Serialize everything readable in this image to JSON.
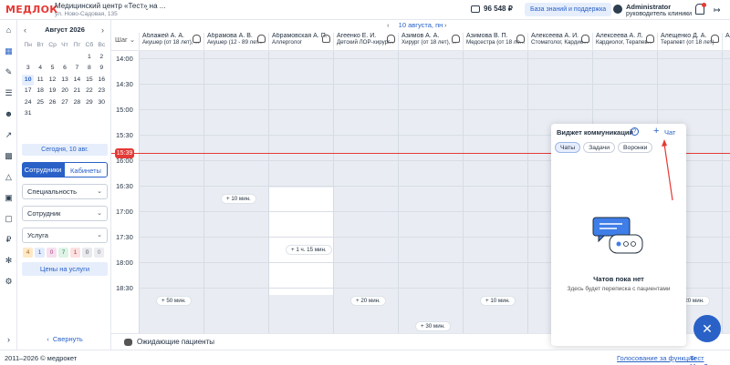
{
  "header": {
    "logo": "МЕДЛОК",
    "clinic_name": "Медицинский центр «Тест» на ...",
    "clinic_address": "ул. Ново-Садовая, 135",
    "balance": "96 548 ₽",
    "knowledge_base": "База знаний и поддержка",
    "user_name": "Administrator",
    "user_role": "руководитель клиники"
  },
  "calendar": {
    "month": "Август 2026",
    "weekdays": [
      "Пн",
      "Вт",
      "Ср",
      "Чт",
      "Пт",
      "Сб",
      "Вс"
    ],
    "weeks": [
      [
        "",
        "",
        "",
        "",
        "",
        "1",
        "2"
      ],
      [
        "3",
        "4",
        "5",
        "6",
        "7",
        "8",
        "9"
      ],
      [
        "10",
        "11",
        "12",
        "13",
        "14",
        "15",
        "16"
      ],
      [
        "17",
        "18",
        "19",
        "20",
        "21",
        "22",
        "23"
      ],
      [
        "24",
        "25",
        "26",
        "27",
        "28",
        "29",
        "30"
      ],
      [
        "31",
        "",
        "",
        "",
        "",
        "",
        ""
      ]
    ],
    "selected_day": "10",
    "today_button": "Сегодня, 10 авг."
  },
  "filters": {
    "tab_staff": "Сотрудники",
    "tab_rooms": "Кабинеты",
    "specialty": "Специальность",
    "employee": "Сотрудник",
    "service": "Услуга",
    "badges": [
      {
        "value": "4",
        "bg": "#fde9c8",
        "fg": "#a8641a"
      },
      {
        "value": "1",
        "bg": "#e3ecfb",
        "fg": "#2961c7"
      },
      {
        "value": "0",
        "bg": "#f6e0ee",
        "fg": "#a63d7c"
      },
      {
        "value": "7",
        "bg": "#dff3e6",
        "fg": "#2e8b57"
      },
      {
        "value": "1",
        "bg": "#fbe1e1",
        "fg": "#c0392b"
      },
      {
        "value": "0",
        "bg": "#e7e9ee",
        "fg": "#555555"
      },
      {
        "value": "0",
        "bg": "#ecedf1",
        "fg": "#888888"
      }
    ],
    "prices_button": "Цены на услуги",
    "collapse": "Свернуть"
  },
  "schedule": {
    "date": "10 августа, пн",
    "step_label": "Шаг",
    "now_time": "15:39",
    "times": [
      "14:00",
      "14:30",
      "15:00",
      "15:30",
      "16:00",
      "16:30",
      "17:00",
      "17:30",
      "18:00",
      "18:30"
    ],
    "doctors": [
      {
        "name": "Аблажей А. А.",
        "spec": "Акушер (от 18 лет), ..."
      },
      {
        "name": "Абрамова А. В.",
        "spec": "Акушер (12 - 89 лет..."
      },
      {
        "name": "Абрамовская А. П.",
        "spec": "Аллерголог"
      },
      {
        "name": "Агеенко Е. И.",
        "spec": "Детский ЛОР-хирург..."
      },
      {
        "name": "Азимов А. А.",
        "spec": "Хирург (от 18 лет), ..."
      },
      {
        "name": "Азимова В. П.",
        "spec": "Медсестра (от 18 ле..."
      },
      {
        "name": "Алексеева А. И.",
        "spec": "Стоматолог, Кардио..."
      },
      {
        "name": "Алексеева А. Л.",
        "spec": "Кардиолог, Терапев..."
      },
      {
        "name": "Алещенко Д. А.",
        "spec": "Терапевт (от 18 лет)"
      },
      {
        "name": "Ал...",
        "spec": ""
      }
    ],
    "durations": [
      "+ 10 мин.",
      "+ 1 ч. 15 мин.",
      "+ 50 мин.",
      "+ 20 мин.",
      "+ 10 мин.",
      "+ 30 мин.",
      "+ 20 мин."
    ],
    "waiting": "Ожидающие пациенты"
  },
  "widget": {
    "title": "Виджет коммуникаций",
    "help": "?",
    "new_chat": "Чат",
    "tabs": [
      "Чаты",
      "Задачи",
      "Воронки"
    ],
    "empty_title": "Чатов пока нет",
    "empty_sub": "Здесь будет переписка с пациентами"
  },
  "footer": {
    "copyright": "2011–2026 © медрокет",
    "vote": "Голосование за функции",
    "test": "Тест МедЛок"
  }
}
